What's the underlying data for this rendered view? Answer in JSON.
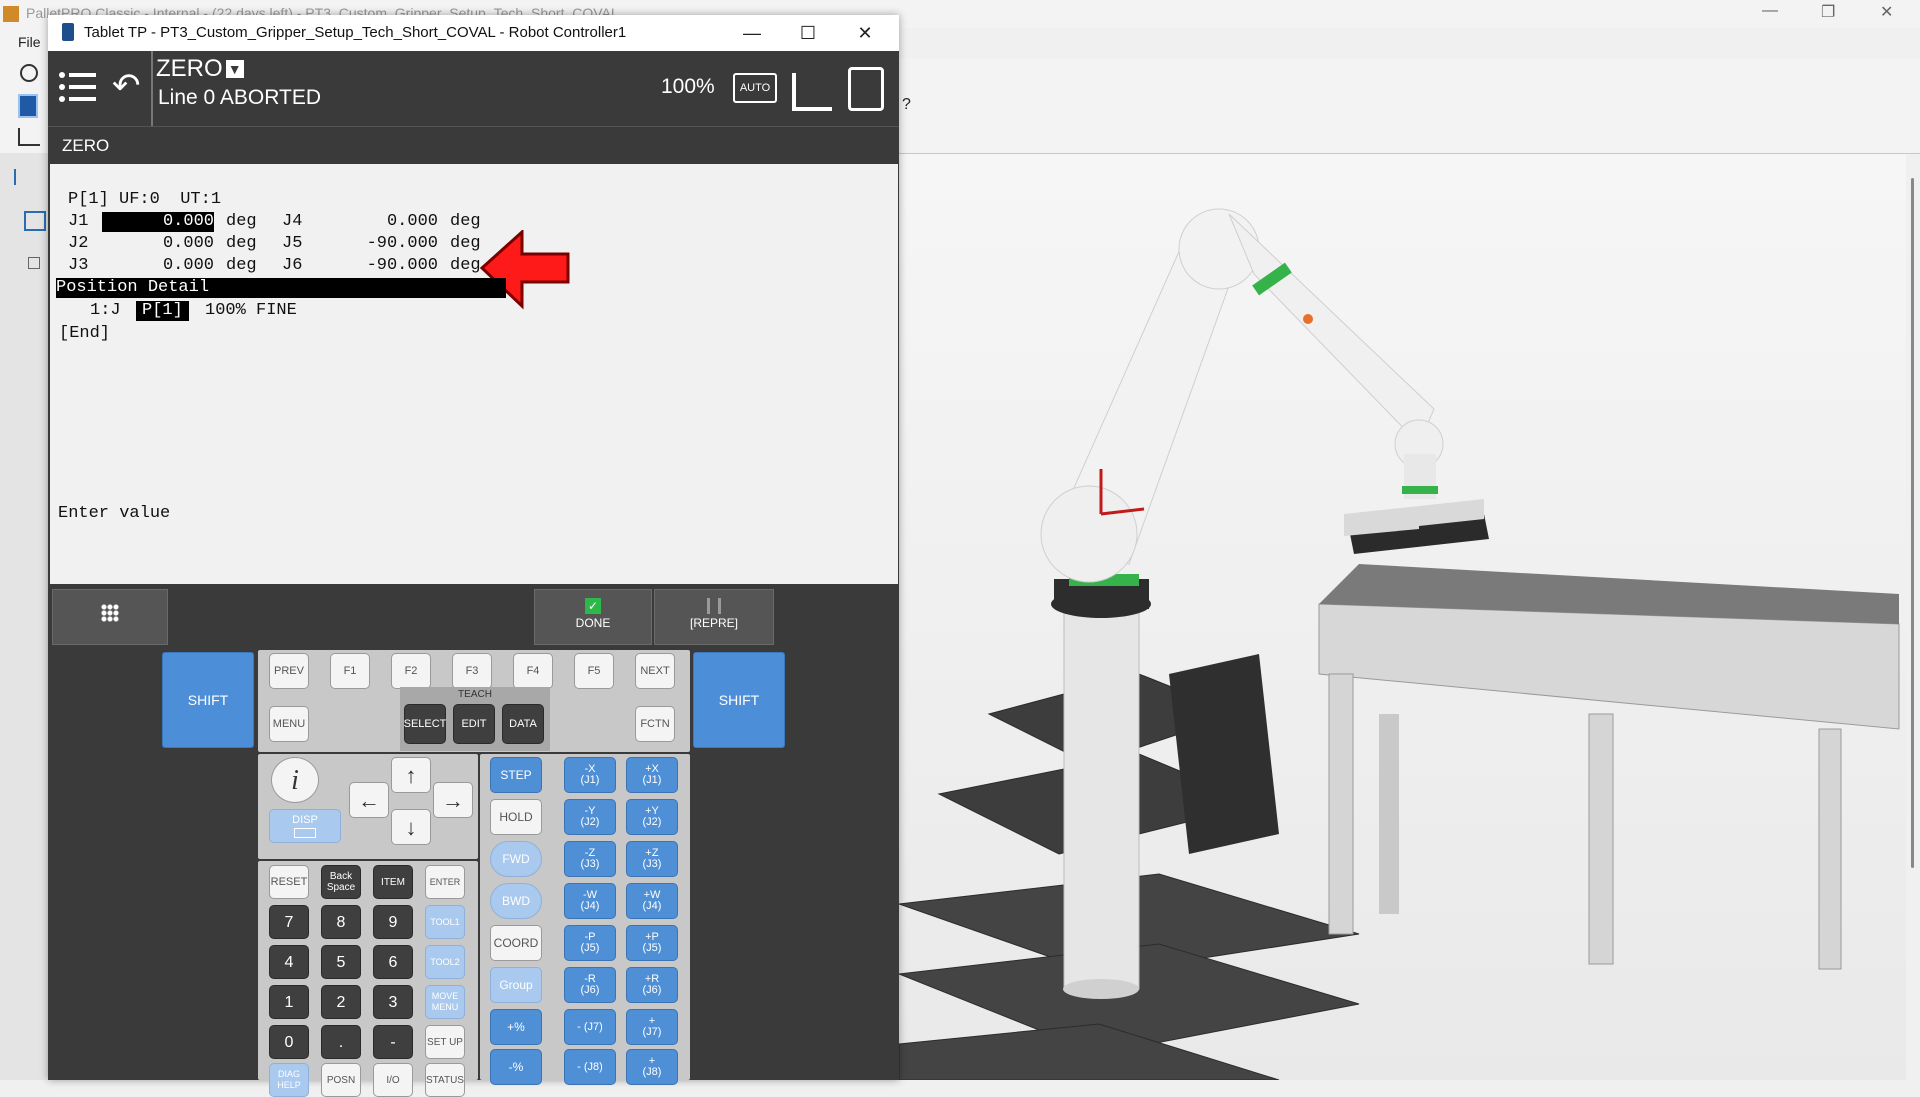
{
  "background_app": {
    "title": "PalletPRO Classic - Internal - (22 days left) - PT3_Custom_Gripper_Setup_Tech_Short_COVAL",
    "menu_file": "File"
  },
  "tp_window": {
    "title": "Tablet TP - PT3_Custom_Gripper_Setup_Tech_Short_COVAL - Robot Controller1",
    "status": {
      "program": "ZERO",
      "line_status": "Line 0 ABORTED",
      "override": "100%"
    },
    "screen_title": "ZERO",
    "position": {
      "header": "P[1] UF:0  UT:1",
      "joints": [
        {
          "label": "J1",
          "value": "0.000",
          "unit": "deg"
        },
        {
          "label": "J2",
          "value": "0.000",
          "unit": "deg"
        },
        {
          "label": "J3",
          "value": "0.000",
          "unit": "deg"
        },
        {
          "label": "J4",
          "value": "0.000",
          "unit": "deg"
        },
        {
          "label": "J5",
          "value": "-90.000",
          "unit": "deg"
        },
        {
          "label": "J6",
          "value": "-90.000",
          "unit": "deg"
        }
      ],
      "detail_label": "Position Detail",
      "program_line_num": "1:J",
      "program_line_pos": "P[1]",
      "program_line_rest": "100% FINE",
      "end_marker": "[End]"
    },
    "prompt": "Enter value",
    "function_keys": {
      "done": "DONE",
      "repre": "[REPRE]"
    }
  },
  "keypad": {
    "shift": "SHIFT",
    "top_row": [
      "PREV",
      "F1",
      "F2",
      "F3",
      "F4",
      "F5",
      "NEXT"
    ],
    "menu": "MENU",
    "teach": "TEACH",
    "select": "SELECT",
    "edit": "EDIT",
    "data": "DATA",
    "fctn": "FCTN",
    "info": "i",
    "disp": "DISP",
    "reset": "RESET",
    "backspace": "Back Space",
    "item": "ITEM",
    "enter": "ENTER",
    "digits": [
      "7",
      "8",
      "9",
      "4",
      "5",
      "6",
      "1",
      "2",
      "3",
      "0",
      ".",
      "-"
    ],
    "tool1": "TOOL1",
    "tool2": "TOOL2",
    "move_menu": "MOVE MENU",
    "setup": "SET UP",
    "diag_help": "DIAG HELP",
    "posn": "POSN",
    "io": "I/O",
    "status": "STATUS",
    "step": "STEP",
    "hold": "HOLD",
    "fwd": "FWD",
    "bwd": "BWD",
    "coord": "COORD",
    "group": "Group",
    "speed_up": "+%",
    "speed_down": "-%",
    "jog_minus": [
      "-X (J1)",
      "-Y (J2)",
      "-Z (J3)",
      "-W (J4)",
      "-P (J5)",
      "-R (J6)",
      "- (J7)",
      "- (J8)"
    ],
    "jog_plus": [
      "+X (J1)",
      "+Y (J2)",
      "+Z (J3)",
      "+W (J4)",
      "+P (J5)",
      "+R (J6)",
      "+ (J7)",
      "+ (J8)"
    ]
  }
}
